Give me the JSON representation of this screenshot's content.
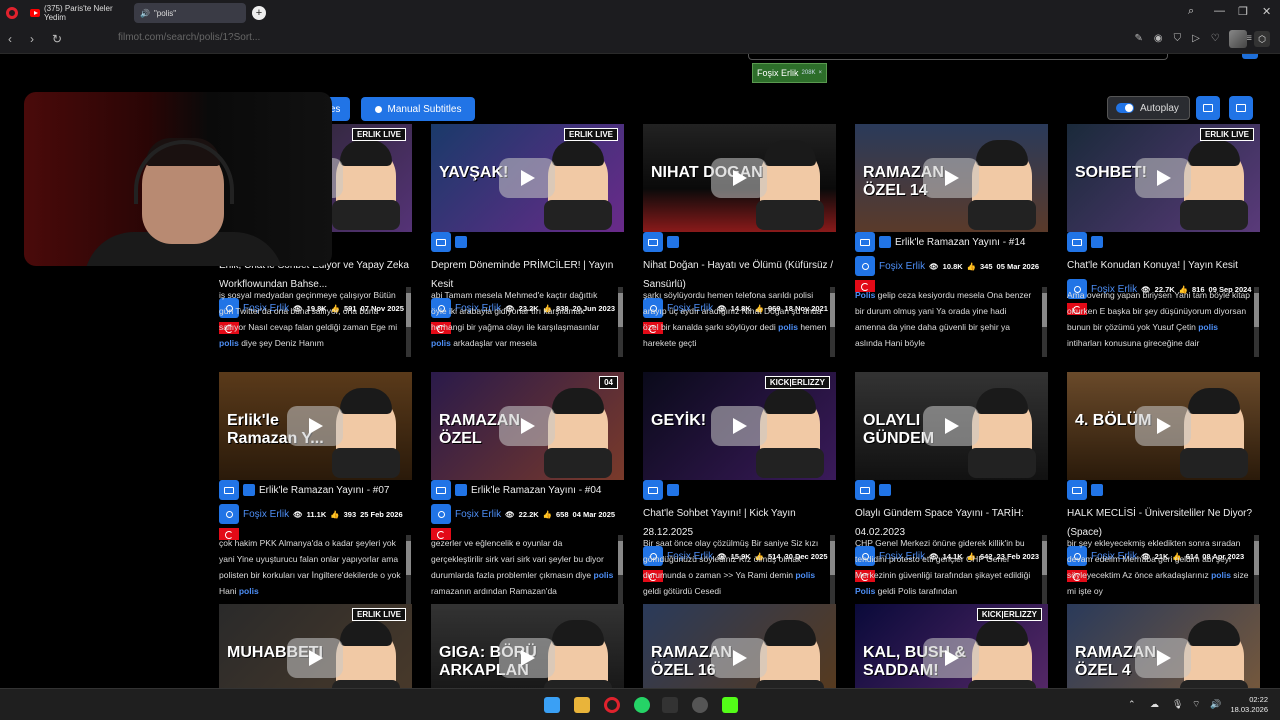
{
  "browser": {
    "tabs": [
      {
        "label": "(375) Paris'te Neler Yedim"
      },
      {
        "label": "\"polis\""
      }
    ],
    "url": "filmot.com/search/polis/1?Sort...",
    "time": "02:22",
    "date": "18.03.2026"
  },
  "filter_chip": {
    "label": "Foşix Erlik",
    "count": "208K",
    "close": "×"
  },
  "toolbar": {
    "subtitles_label": "les",
    "manual_subtitles_label": "Manual Subtitles",
    "autoplay_label": "Autoplay"
  },
  "cards": [
    {
      "title": "Erlik, Chat'le Sohbet Ediyor ve Yapay Zeka Workflowundan Bahse...",
      "channel": "Foşix Erlik",
      "views": "19.8K",
      "likes": "591",
      "date": "07 Nov 2025",
      "desc_before": "iş sosyal medyadan geçinmeye çalışıyor Bütün gün Twitter'da ona buna sallıyor, ona buna sallıyor Nasıl cevap falan geldiği zaman Ege mi ",
      "kw": "polis",
      "desc_after": " diye şey Deniz Hanım",
      "thumb_text": "",
      "tag": "ERLIK LIVE"
    },
    {
      "title": "Deprem Döneminde PRİMCİLER! | Yayın Kesit",
      "channel": "Foşix Erlik",
      "views": "23.2K",
      "likes": "838",
      "date": "20 Jun 2023",
      "desc_before": "abi Tamam mesela Mehmed'e kaçtır dağıttık öyle iki arabayla gidiyorlar tırı karşılamak herhangi bir yağma olayı ile karşılaşmasınlar ",
      "kw": "polis",
      "desc_after": " arkadaşlar var mesela",
      "thumb_text": "YAVŞAK!",
      "tag": "ERLIK LIVE"
    },
    {
      "title": "Nihat Doğan - Hayatı ve Ölümü (Küfürsüz / Sansürlü)",
      "channel": "Foşix Erlik",
      "views": "14.8K",
      "likes": "969",
      "date": "18 Nov 2021",
      "desc_before": "şarkı söylüyordu hemen telefona sarıldı polisi arayıp üç aydır aradığınız Nihat Doğan şu anda özel bir kanalda şarkı söylüyor dedi ",
      "kw": "polis",
      "desc_after": " hemen harekete geçti",
      "thumb_text": "NIHAT DOGAN",
      "tag": ""
    },
    {
      "title": "Erlik'le Ramazan Yayını - #14",
      "channel": "Foşix Erlik",
      "views": "10.8K",
      "likes": "345",
      "date": "05 Mar 2026",
      "desc_before": "",
      "kw": "Polis",
      "desc_after": " gelip ceza kesiyordu mesela Ona benzer bir durum olmuş yani Ya orada yine hadi amenna da yine daha güvenli bir şehir ya aslında Hani böyle",
      "thumb_text": "RAMAZAN ÖZEL 14",
      "tag": ""
    },
    {
      "title": "Chat'le Konudan Konuya! | Yayın Kesit",
      "channel": "Foşix Erlik",
      "views": "22.7K",
      "likes": "816",
      "date": "09 Sep 2024",
      "desc_before": "Ama overing yapan biriysen Yani tam böyle kitap okurken E başka bir şey düşünüyorum diyorsan bunun bir çözümü yok Yusuf Çetin ",
      "kw": "polis",
      "desc_after": " intiharları konusuna gireceğine dair",
      "thumb_text": "SOHBET!",
      "tag": "ERLIK LIVE"
    },
    {
      "title": "Erlik'le Ramazan Yayını - #07",
      "channel": "Foşix Erlik",
      "views": "11.1K",
      "likes": "393",
      "date": "25 Feb 2026",
      "desc_before": "çok hakim PKK Almanya'da o kadar şeyleri yok yani Yine uyuşturucu falan onlar yapıyorlar ama polisten bir korkuları var İngiltere'dekilerde o yok Hani ",
      "kw": "polis",
      "desc_after": "",
      "thumb_text": "Erlik'le Ramazan Y...",
      "tag": ""
    },
    {
      "title": "Erlik'le Ramazan Yayını - #04",
      "channel": "Foşix Erlik",
      "views": "22.2K",
      "likes": "658",
      "date": "04 Mar 2025",
      "desc_before": "gezerler ve eğlencelik e oyunlar da gerçekleştirilir sirk vari sirk vari şeyler bu diyor durumlarda fazla problemler çıkmasın diye ",
      "kw": "polis",
      "desc_after": " ramazanın ardından Ramazan'da",
      "thumb_text": "RAMAZAN ÖZEL",
      "tag": "04"
    },
    {
      "title": "Chat'le Sohbet Yayını! | Kick Yayın 28.12.2025",
      "channel": "Foşix Erlik",
      "views": "15.9K",
      "likes": "514",
      "date": "30 Dec 2025",
      "desc_before": "Bir saat önce olay çözülmüş Bir saniye Siz kızı gömdüğünüzü söylediniz Kız ölmüş olmak durumunda o zaman >> Ya Rami demin ",
      "kw": "polis",
      "desc_after": " geldi götürdü Cesedi",
      "thumb_text": "GEYİK!",
      "tag": "KICK|ERLIZZY"
    },
    {
      "title": "Olaylı Gündem Space Yayını - TARİH: 04.02.2023",
      "channel": "Foşix Erlik",
      "views": "14.1K",
      "likes": "642",
      "date": "23 Feb 2023",
      "desc_before": "CHP Genel Merkezi önüne giderek killik'in bu tehdidini protesto etti gençler CHP Genel Merkezinin güvenliği tarafından şikayet edildiği ",
      "kw": "Polis",
      "desc_after": " geldi Polis tarafından",
      "thumb_text": "OLAYLI GÜNDEM",
      "tag": ""
    },
    {
      "title": "HALK MECLİSİ - Üniversiteliler Ne Diyor? (Space)",
      "channel": "Foşix Erlik",
      "views": "21K",
      "likes": "614",
      "date": "08 Apr 2023",
      "desc_before": "bir şey ekleyecekmiş ekledikten sonra sıradan devam edelim Merhaba geri geldim abi şeyi söyleyecektim Az önce arkadaşlarınız ",
      "kw": "polis",
      "desc_after": " size mi işte oy",
      "thumb_text": "4. BÖLÜM",
      "tag": ""
    },
    {
      "title": "",
      "channel": "",
      "views": "",
      "likes": "",
      "date": "",
      "desc_before": "",
      "kw": "",
      "desc_after": "",
      "thumb_text": "MUHABBETI",
      "tag": "ERLIK LIVE"
    },
    {
      "title": "",
      "channel": "",
      "views": "",
      "likes": "",
      "date": "",
      "desc_before": "",
      "kw": "",
      "desc_after": "",
      "thumb_text": "GIGA: BÖRÜ ARKAPLAN",
      "tag": ""
    },
    {
      "title": "",
      "channel": "",
      "views": "",
      "likes": "",
      "date": "",
      "desc_before": "",
      "kw": "",
      "desc_after": "",
      "thumb_text": "RAMAZAN ÖZEL 16",
      "tag": ""
    },
    {
      "title": "",
      "channel": "",
      "views": "",
      "likes": "",
      "date": "",
      "desc_before": "",
      "kw": "",
      "desc_after": "",
      "thumb_text": "KAL, BUSH & SADDAM!",
      "tag": "KICK|ERLIZZY"
    },
    {
      "title": "",
      "channel": "",
      "views": "",
      "likes": "",
      "date": "",
      "desc_before": "",
      "kw": "",
      "desc_after": "",
      "thumb_text": "RAMAZAN ÖZEL 4",
      "tag": ""
    }
  ],
  "colors": {
    "accent": "#2174e6",
    "channel": "#4d8ef5"
  }
}
